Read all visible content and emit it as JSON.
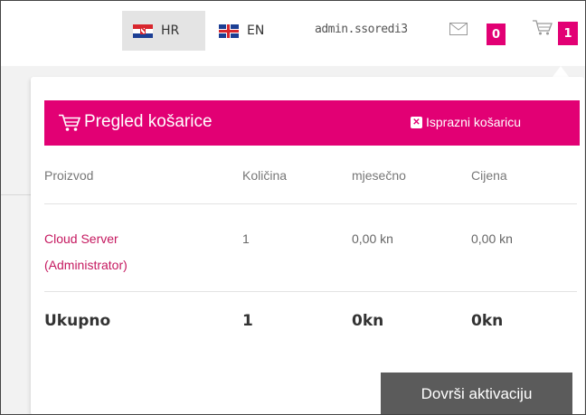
{
  "header": {
    "languages": [
      {
        "code": "HR",
        "flag": "croatia-flag-icon",
        "active": true
      },
      {
        "code": "EN",
        "flag": "uk-flag-icon",
        "active": false
      }
    ],
    "username": "admin.ssoredi3",
    "messages_count": "0",
    "cart_count": "1"
  },
  "cart_panel": {
    "title": "Pregled košarice",
    "empty_label": "Isprazni košaricu",
    "columns": [
      "Proizvod",
      "Količina",
      "mjesečno",
      "Cijena"
    ],
    "items": [
      {
        "product": "Cloud Server (Administrator)",
        "product_line1": "Cloud Server",
        "product_line2": "(Administrator)",
        "quantity": "1",
        "monthly": "0,00 kn",
        "price": "0,00 kn"
      }
    ],
    "total": {
      "label": "Ukupno",
      "quantity": "1",
      "monthly": "0kn",
      "price": "0kn"
    },
    "checkout_label": "Dovrši aktivaciju"
  },
  "colors": {
    "accent": "#e20074",
    "button": "#5b5b5b",
    "product_link": "#c5185f"
  }
}
